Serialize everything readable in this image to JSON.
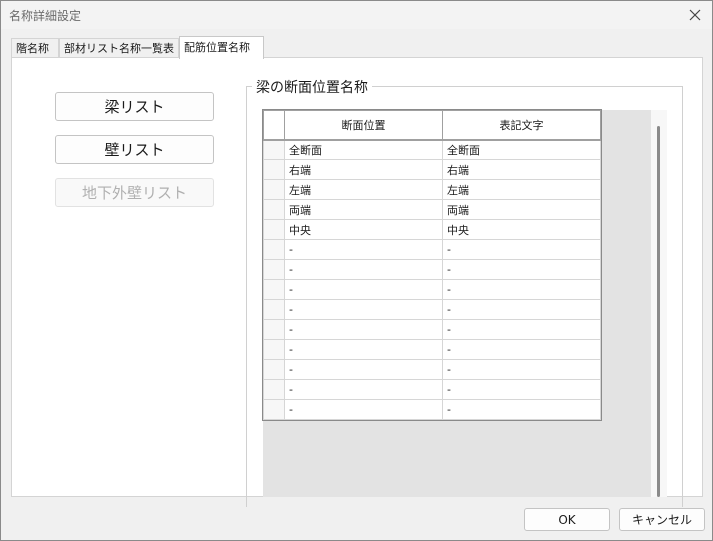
{
  "window": {
    "title": "名称詳細設定"
  },
  "tabs": [
    {
      "label": "階名称"
    },
    {
      "label": "部材リスト名称一覧表"
    },
    {
      "label": "配筋位置名称"
    }
  ],
  "left_buttons": {
    "beam_list": "梁リスト",
    "wall_list": "壁リスト",
    "underground_wall_list": "地下外壁リスト"
  },
  "group": {
    "title": "梁の断面位置名称",
    "columns": [
      "断面位置",
      "表記文字"
    ],
    "rows": [
      [
        "全断面",
        "全断面"
      ],
      [
        "右端",
        "右端"
      ],
      [
        "左端",
        "左端"
      ],
      [
        "両端",
        "両端"
      ],
      [
        "中央",
        "中央"
      ],
      [
        "-",
        "-"
      ],
      [
        "-",
        "-"
      ],
      [
        "-",
        "-"
      ],
      [
        "-",
        "-"
      ],
      [
        "-",
        "-"
      ],
      [
        "-",
        "-"
      ],
      [
        "-",
        "-"
      ],
      [
        "-",
        "-"
      ],
      [
        "-",
        "-"
      ]
    ]
  },
  "footer": {
    "ok": "OK",
    "cancel": "キャンセル"
  },
  "icons": {
    "close": "close-icon"
  },
  "colors": {
    "disabled_text": "#b0b0b0",
    "grid_background": "#e3e3e3"
  }
}
